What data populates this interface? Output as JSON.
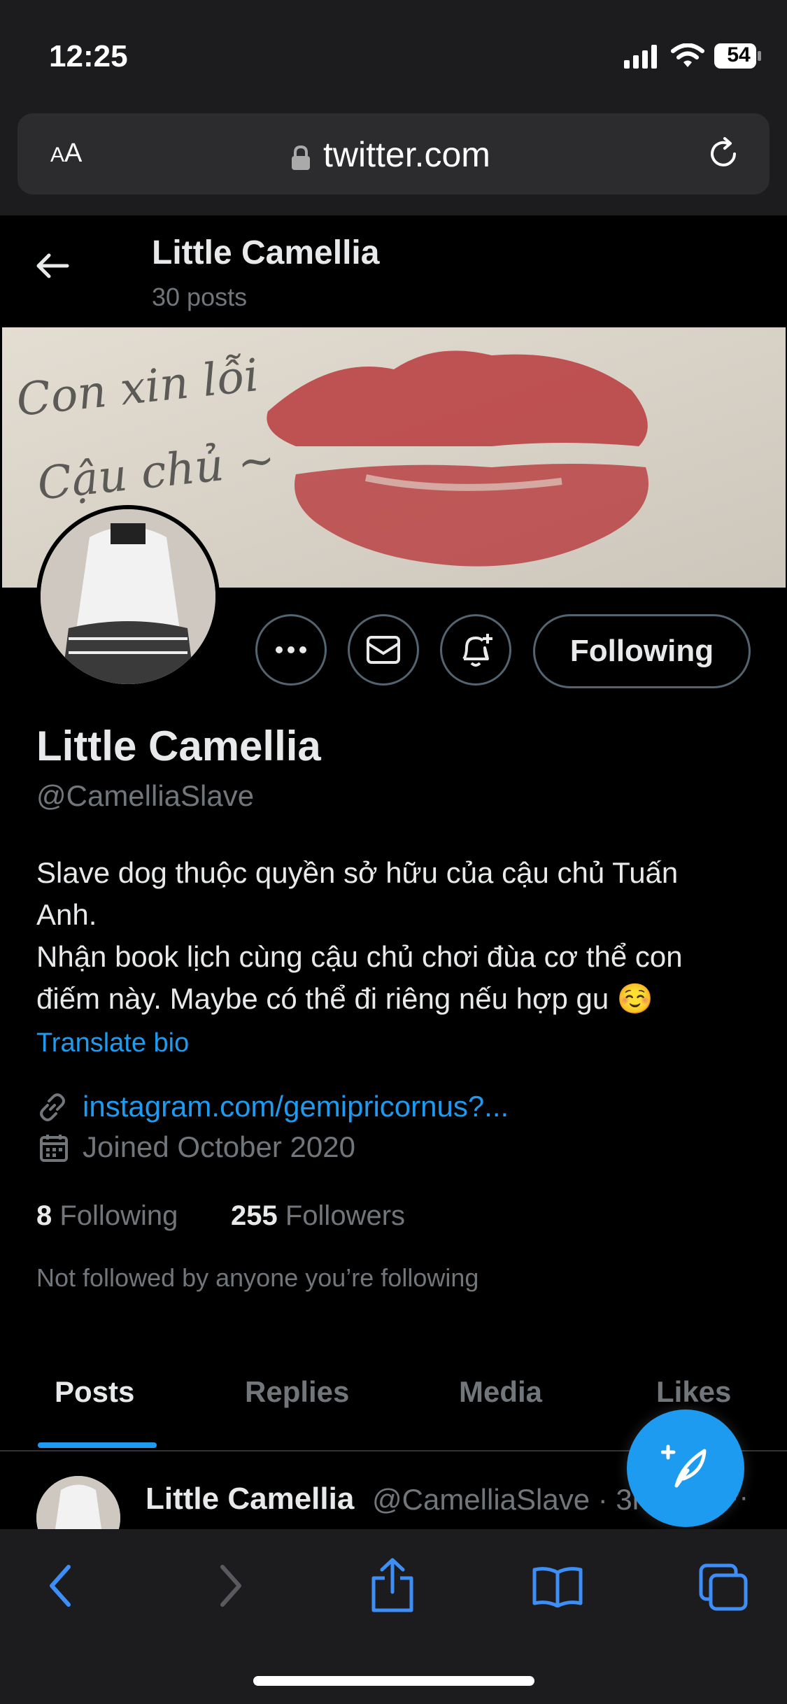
{
  "status_bar": {
    "time": "12:25",
    "battery": "54"
  },
  "browser": {
    "aa_label_small": "A",
    "aa_label_large": "A",
    "url": "twitter.com"
  },
  "header": {
    "name": "Little Camellia",
    "posts": "30 posts"
  },
  "profile": {
    "display_name": "Little Camellia",
    "handle": "@CamelliaSlave",
    "bio_lines": [
      "Slave dog thuộc quyền sở hữu của cậu chủ Tuấn",
      "Anh.",
      "Nhận book lịch cùng cậu chủ chơi đùa cơ thể con",
      "điếm này. Maybe có thể đi riêng nếu hợp gu ☺️"
    ],
    "translate_label": "Translate bio",
    "link": "instagram.com/gemipricornus?...",
    "joined": "Joined October 2020",
    "following_count": "8",
    "following_label": " Following",
    "followers_count": "255",
    "followers_label": " Followers",
    "not_followed": "Not followed by anyone you’re following"
  },
  "banner": {
    "handwriting_1": "Con xin lỗi",
    "handwriting_2": "Cậu chủ ~"
  },
  "actions": {
    "following_label": "Following"
  },
  "tabs": [
    "Posts",
    "Replies",
    "Media",
    "Likes"
  ],
  "tweet": {
    "name": "Little Camellia",
    "handle": "@CamelliaSlave · 3h",
    "more": "···"
  },
  "colors": {
    "accent": "#1d9bf0",
    "background": "#000000",
    "muted": "#71767b"
  }
}
